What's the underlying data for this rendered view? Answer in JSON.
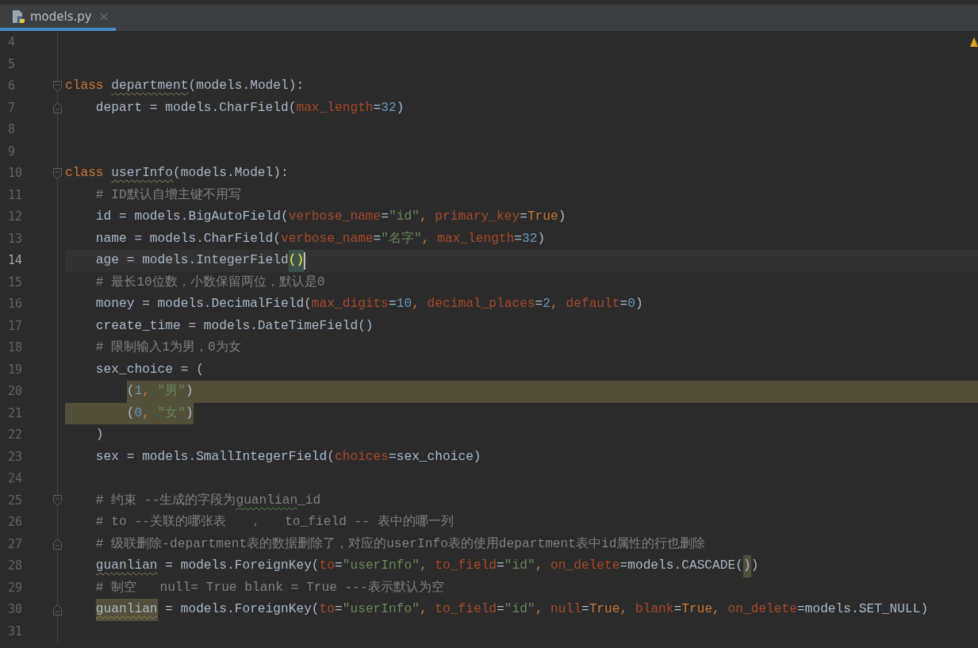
{
  "tabs": [
    {
      "label": "models.py",
      "selected": true
    }
  ],
  "lines": [
    {
      "number": "4",
      "current": false
    },
    {
      "number": "5",
      "current": false
    },
    {
      "number": "6",
      "current": false,
      "fold_start": true,
      "tokens": [
        {
          "text": "class ",
          "kind": "kw"
        },
        {
          "text": "department",
          "kind": "name_warn"
        },
        {
          "text": "(models.Model):",
          "kind": "plain"
        }
      ]
    },
    {
      "number": "7",
      "current": false,
      "fold_end": true,
      "tokens": [
        {
          "text": "    depart = models.CharField(",
          "kind": "plain"
        },
        {
          "text": "max_length",
          "kind": "param"
        },
        {
          "text": "=",
          "kind": "plain"
        },
        {
          "text": "32",
          "kind": "num"
        },
        {
          "text": ")",
          "kind": "plain"
        }
      ]
    },
    {
      "number": "8",
      "current": false
    },
    {
      "number": "9",
      "current": false
    },
    {
      "number": "10",
      "current": false,
      "fold_start": true,
      "tokens": [
        {
          "text": "class ",
          "kind": "kw"
        },
        {
          "text": "userInfo",
          "kind": "name_warn"
        },
        {
          "text": "(models.Model):",
          "kind": "plain"
        }
      ]
    },
    {
      "number": "11",
      "current": false,
      "tokens": [
        {
          "text": "    # ID默认自增主键不用写",
          "kind": "comment"
        }
      ]
    },
    {
      "number": "12",
      "current": false,
      "tokens": [
        {
          "text": "    id = models.BigAutoField(",
          "kind": "plain"
        },
        {
          "text": "verbose_name",
          "kind": "param"
        },
        {
          "text": "=",
          "kind": "plain"
        },
        {
          "text": "\"id\"",
          "kind": "str"
        },
        {
          "text": ", ",
          "kind": "kw"
        },
        {
          "text": "primary_key",
          "kind": "param"
        },
        {
          "text": "=",
          "kind": "plain"
        },
        {
          "text": "True",
          "kind": "const"
        },
        {
          "text": ")",
          "kind": "plain"
        }
      ]
    },
    {
      "number": "13",
      "current": false,
      "tokens": [
        {
          "text": "    name = models.CharField(",
          "kind": "plain"
        },
        {
          "text": "verbose_name",
          "kind": "param"
        },
        {
          "text": "=",
          "kind": "plain"
        },
        {
          "text": "\"名字\"",
          "kind": "str"
        },
        {
          "text": ", ",
          "kind": "kw"
        },
        {
          "text": "max_length",
          "kind": "param"
        },
        {
          "text": "=",
          "kind": "plain"
        },
        {
          "text": "32",
          "kind": "num"
        },
        {
          "text": ")",
          "kind": "plain"
        }
      ]
    },
    {
      "number": "14",
      "current": true,
      "tokens": [
        {
          "text": "    age = models.IntegerField",
          "kind": "plain"
        },
        {
          "text": "()",
          "kind": "match"
        }
      ]
    },
    {
      "number": "15",
      "current": false,
      "tokens": [
        {
          "text": "    # 最长10位数，小数保留两位，默认是0",
          "kind": "comment"
        }
      ]
    },
    {
      "number": "16",
      "current": false,
      "tokens": [
        {
          "text": "    money = models.DecimalField(",
          "kind": "plain"
        },
        {
          "text": "max_digits",
          "kind": "param"
        },
        {
          "text": "=",
          "kind": "plain"
        },
        {
          "text": "10",
          "kind": "num"
        },
        {
          "text": ", ",
          "kind": "kw"
        },
        {
          "text": "decimal_places",
          "kind": "param"
        },
        {
          "text": "=",
          "kind": "plain"
        },
        {
          "text": "2",
          "kind": "num"
        },
        {
          "text": ", ",
          "kind": "kw"
        },
        {
          "text": "default",
          "kind": "param"
        },
        {
          "text": "=",
          "kind": "plain"
        },
        {
          "text": "0",
          "kind": "num"
        },
        {
          "text": ")",
          "kind": "plain"
        }
      ]
    },
    {
      "number": "17",
      "current": false,
      "tokens": [
        {
          "text": "    create_time = models.DateTimeField()",
          "kind": "plain"
        }
      ]
    },
    {
      "number": "18",
      "current": false,
      "tokens": [
        {
          "text": "    # 限制输入1为男，0为女",
          "kind": "comment"
        }
      ]
    },
    {
      "number": "19",
      "current": false,
      "tokens": [
        {
          "text": "    sex_choice = (",
          "kind": "plain"
        }
      ]
    },
    {
      "number": "20",
      "current": false,
      "highlight_to_line_end": true,
      "tokens": [
        {
          "text": "        (",
          "kind": "plain"
        },
        {
          "text": "1",
          "kind": "num"
        },
        {
          "text": ", ",
          "kind": "kw"
        },
        {
          "text": "\"男\"",
          "kind": "str"
        },
        {
          "text": ")",
          "kind": "plain"
        }
      ]
    },
    {
      "number": "21",
      "current": false,
      "highlight_with_indent": true,
      "tokens": [
        {
          "text": "        (",
          "kind": "plain"
        },
        {
          "text": "0",
          "kind": "num"
        },
        {
          "text": ", ",
          "kind": "kw"
        },
        {
          "text": "\"女\"",
          "kind": "str"
        },
        {
          "text": ")",
          "kind": "plain"
        }
      ]
    },
    {
      "number": "22",
      "current": false,
      "tokens": [
        {
          "text": "    )",
          "kind": "plain"
        }
      ]
    },
    {
      "number": "23",
      "current": false,
      "tokens": [
        {
          "text": "    sex = models.SmallIntegerField(",
          "kind": "plain"
        },
        {
          "text": "choices",
          "kind": "param"
        },
        {
          "text": "=sex_choice)",
          "kind": "plain"
        }
      ]
    },
    {
      "number": "24",
      "current": false
    },
    {
      "number": "25",
      "current": false,
      "fold_start": true,
      "tokens": [
        {
          "text": "    # 约束 --生成的字段为",
          "kind": "comment"
        },
        {
          "text": "guanlian",
          "kind": "comment_warn"
        },
        {
          "text": "_id",
          "kind": "comment"
        }
      ]
    },
    {
      "number": "26",
      "current": false,
      "tokens": [
        {
          "text": "    # to --关联的哪张表   ，   to_field -- 表中的哪一列",
          "kind": "comment"
        }
      ]
    },
    {
      "number": "27",
      "current": false,
      "fold_end": true,
      "tokens": [
        {
          "text": "    # 级联删除-department表的数据删除了，对应的userInfo表的使用department表中id属性的行也删除",
          "kind": "comment"
        }
      ]
    },
    {
      "number": "28",
      "current": false,
      "tokens": [
        {
          "text": "    guanlian",
          "kind": "name_warn"
        },
        {
          "text": " = models.ForeignKey(",
          "kind": "plain"
        },
        {
          "text": "to",
          "kind": "param"
        },
        {
          "text": "=",
          "kind": "plain"
        },
        {
          "text": "\"userInfo\"",
          "kind": "str"
        },
        {
          "text": ", ",
          "kind": "kw"
        },
        {
          "text": "to_field",
          "kind": "param"
        },
        {
          "text": "=",
          "kind": "plain"
        },
        {
          "text": "\"id\"",
          "kind": "str"
        },
        {
          "text": ", ",
          "kind": "kw"
        },
        {
          "text": "on_delete",
          "kind": "param"
        },
        {
          "text": "=models.CASCADE(",
          "kind": "plain"
        },
        {
          "text": ")",
          "kind": "usage"
        },
        {
          "text": ")",
          "kind": "plain"
        }
      ]
    },
    {
      "number": "29",
      "current": false,
      "tokens": [
        {
          "text": "    # 制空   null= True blank = True ---表示默认为空",
          "kind": "comment"
        }
      ]
    },
    {
      "number": "30",
      "current": false,
      "fold_end": true,
      "tokens": [
        {
          "text": "    guanlian",
          "kind": "usage_warn"
        },
        {
          "text": " = models.ForeignKey(",
          "kind": "plain"
        },
        {
          "text": "to",
          "kind": "param"
        },
        {
          "text": "=",
          "kind": "plain"
        },
        {
          "text": "\"userInfo\"",
          "kind": "str"
        },
        {
          "text": ", ",
          "kind": "kw"
        },
        {
          "text": "to_field",
          "kind": "param"
        },
        {
          "text": "=",
          "kind": "plain"
        },
        {
          "text": "\"id\"",
          "kind": "str"
        },
        {
          "text": ", ",
          "kind": "kw"
        },
        {
          "text": "null",
          "kind": "param"
        },
        {
          "text": "=",
          "kind": "plain"
        },
        {
          "text": "True",
          "kind": "const"
        },
        {
          "text": ", ",
          "kind": "kw"
        },
        {
          "text": "blank",
          "kind": "param"
        },
        {
          "text": "=",
          "kind": "plain"
        },
        {
          "text": "True",
          "kind": "const"
        },
        {
          "text": ", ",
          "kind": "kw"
        },
        {
          "text": "on_delete",
          "kind": "param"
        },
        {
          "text": "=models.SET_NULL)",
          "kind": "plain"
        }
      ]
    },
    {
      "number": "31",
      "current": false
    }
  ]
}
